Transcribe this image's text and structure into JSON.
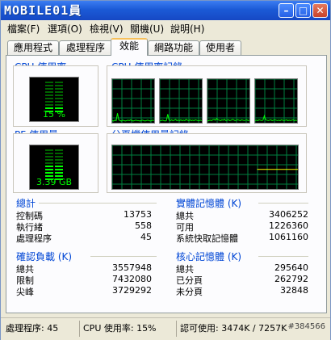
{
  "window": {
    "logo_text": "MOBILE01",
    "logo_suffix": "員"
  },
  "menu": [
    "檔案(F)",
    "選項(O)",
    "檢視(V)",
    "關機(U)",
    "說明(H)"
  ],
  "tabs": [
    "應用程式",
    "處理程序",
    "效能",
    "網路功能",
    "使用者"
  ],
  "active_tab": 2,
  "cpu": {
    "label": "CPU 使用率",
    "value": "15 %",
    "level_percent": 15
  },
  "cpu_history": {
    "label": "CPU 使用率記錄",
    "graphs": [
      [
        3,
        2,
        4,
        3,
        20,
        5,
        3,
        2,
        4,
        3,
        2,
        3,
        4,
        3,
        5,
        3,
        2,
        3,
        4,
        3,
        3,
        2,
        3,
        4,
        3,
        2,
        3,
        4,
        3,
        2,
        3,
        4,
        3
      ],
      [
        3,
        3,
        4,
        3,
        2,
        3,
        18,
        4,
        3,
        5,
        3,
        4,
        6,
        3,
        4,
        3,
        5,
        3,
        4,
        3,
        6,
        4,
        3,
        5,
        3,
        4,
        3,
        5,
        4,
        3,
        3,
        4,
        3
      ],
      [
        2,
        3,
        4,
        3,
        5,
        6,
        4,
        8,
        5,
        4,
        3,
        5,
        4,
        6,
        3,
        4,
        5,
        3,
        4,
        6,
        5,
        3,
        4,
        5,
        4,
        3,
        5,
        4,
        3,
        4,
        5,
        3,
        4
      ],
      [
        3,
        4,
        3,
        5,
        4,
        3,
        4,
        14,
        5,
        4,
        3,
        4,
        5,
        3,
        4,
        5,
        4,
        3,
        4,
        3,
        5,
        4,
        3,
        4,
        5,
        3,
        4,
        3,
        4,
        5,
        3,
        4,
        3
      ]
    ]
  },
  "pf": {
    "label": "PF 使用量",
    "value": "3.39 GB",
    "level_percent": 45
  },
  "pf_history": {
    "label": "分頁檔使用量記錄",
    "start_fraction": 0.78,
    "level_percent": 45
  },
  "totals": {
    "title": "總計",
    "rows": [
      {
        "label": "控制碼",
        "value": "13753"
      },
      {
        "label": "執行緒",
        "value": "558"
      },
      {
        "label": "處理程序",
        "value": "45"
      }
    ]
  },
  "physical": {
    "title": "實體記憶體 (K)",
    "rows": [
      {
        "label": "總共",
        "value": "3406252"
      },
      {
        "label": "可用",
        "value": "1226360"
      },
      {
        "label": "系統快取記憶體",
        "value": "1061160"
      }
    ]
  },
  "commit": {
    "title": "確認負載 (K)",
    "rows": [
      {
        "label": "總共",
        "value": "3557948"
      },
      {
        "label": "限制",
        "value": "7432080"
      },
      {
        "label": "尖峰",
        "value": "3729292"
      }
    ]
  },
  "kernel": {
    "title": "核心記憶體 (K)",
    "rows": [
      {
        "label": "總共",
        "value": "295640"
      },
      {
        "label": "已分頁",
        "value": "262792"
      },
      {
        "label": "未分頁",
        "value": "32848"
      }
    ]
  },
  "status": {
    "processes": "處理程序: 45",
    "cpu": "CPU 使用率: 15%",
    "commit": "認可使用: 3474K / 7257K"
  },
  "watermark": "#384566",
  "colors": {
    "graph_line": "#00ff00",
    "grid": "#008040",
    "label_blue": "#0046d5"
  }
}
